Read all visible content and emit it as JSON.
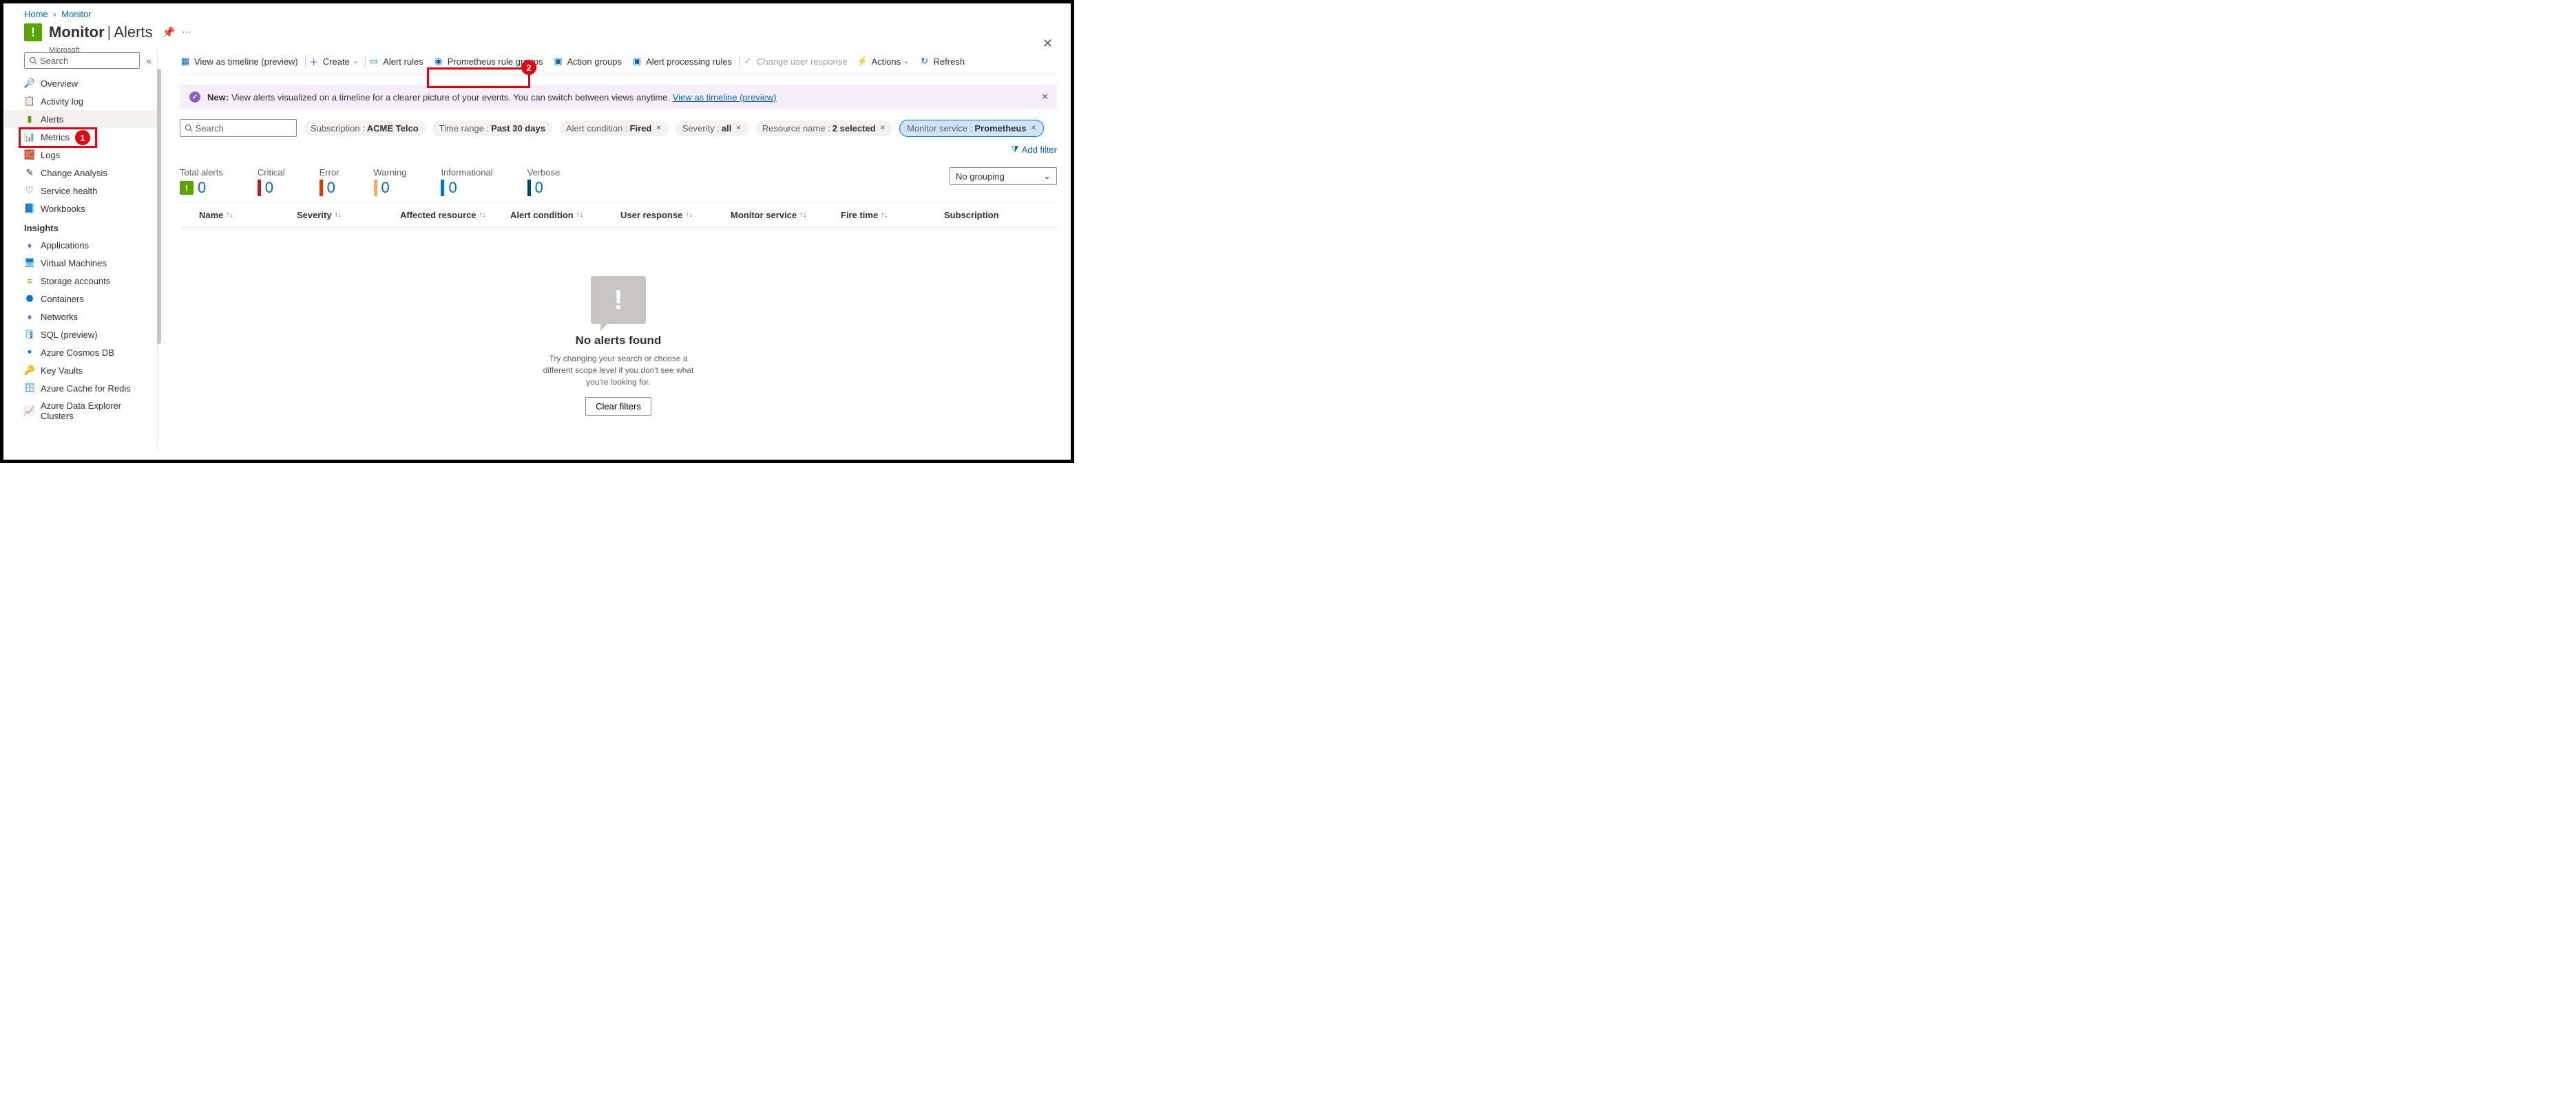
{
  "breadcrumb": {
    "home": "Home",
    "monitor": "Monitor"
  },
  "header": {
    "title_main": "Monitor",
    "title_sub": "Alerts",
    "company": "Microsoft"
  },
  "sidebar": {
    "search_placeholder": "Search",
    "items": [
      {
        "label": "Overview"
      },
      {
        "label": "Activity log"
      },
      {
        "label": "Alerts"
      },
      {
        "label": "Metrics"
      },
      {
        "label": "Logs"
      },
      {
        "label": "Change Analysis"
      },
      {
        "label": "Service health"
      },
      {
        "label": "Workbooks"
      }
    ],
    "insights_header": "Insights",
    "insights": [
      {
        "label": "Applications"
      },
      {
        "label": "Virtual Machines"
      },
      {
        "label": "Storage accounts"
      },
      {
        "label": "Containers"
      },
      {
        "label": "Networks"
      },
      {
        "label": "SQL (preview)"
      },
      {
        "label": "Azure Cosmos DB"
      },
      {
        "label": "Key Vaults"
      },
      {
        "label": "Azure Cache for Redis"
      },
      {
        "label": "Azure Data Explorer Clusters"
      }
    ]
  },
  "toolbar": {
    "view_timeline": "View as timeline (preview)",
    "create": "Create",
    "alert_rules": "Alert rules",
    "prometheus": "Prometheus rule groups",
    "action_groups": "Action groups",
    "alert_processing": "Alert processing rules",
    "change_user": "Change user response",
    "actions": "Actions",
    "refresh": "Refresh"
  },
  "infobar": {
    "badge": "New:",
    "text": "View alerts visualized on a timeline for a clearer picture of your events. You can switch between views anytime.",
    "link": "View as timeline (preview)"
  },
  "search_placeholder": "Search",
  "filters": {
    "subscription": {
      "k": "Subscription :",
      "v": "ACME Telco"
    },
    "timerange": {
      "k": "Time range :",
      "v": "Past 30 days"
    },
    "condition": {
      "k": "Alert condition :",
      "v": "Fired"
    },
    "severity": {
      "k": "Severity :",
      "v": "all"
    },
    "resource": {
      "k": "Resource name :",
      "v": "2 selected"
    },
    "monitor": {
      "k": "Monitor service :",
      "v": "Prometheus"
    },
    "add": "Add filter"
  },
  "stats": {
    "total": {
      "label": "Total alerts",
      "value": "0"
    },
    "critical": {
      "label": "Critical",
      "value": "0",
      "color": "#a4262c"
    },
    "error": {
      "label": "Error",
      "value": "0",
      "color": "#d83b01"
    },
    "warning": {
      "label": "Warning",
      "value": "0",
      "color": "#ffaa44"
    },
    "info": {
      "label": "Informational",
      "value": "0",
      "color": "#0078d4"
    },
    "verbose": {
      "label": "Verbose",
      "value": "0",
      "color": "#004578"
    }
  },
  "grouping": "No grouping",
  "columns": {
    "name": "Name",
    "severity": "Severity",
    "affected": "Affected resource",
    "condition": "Alert condition",
    "user": "User response",
    "monitor": "Monitor service",
    "fire": "Fire time",
    "subscription": "Subscription"
  },
  "empty": {
    "title": "No alerts found",
    "body1": "Try changing your search or choose a",
    "body2": "different scope level if you don't see what",
    "body3": "you're looking for.",
    "button": "Clear filters"
  },
  "annotations": {
    "badge1": "1",
    "badge2": "2"
  }
}
